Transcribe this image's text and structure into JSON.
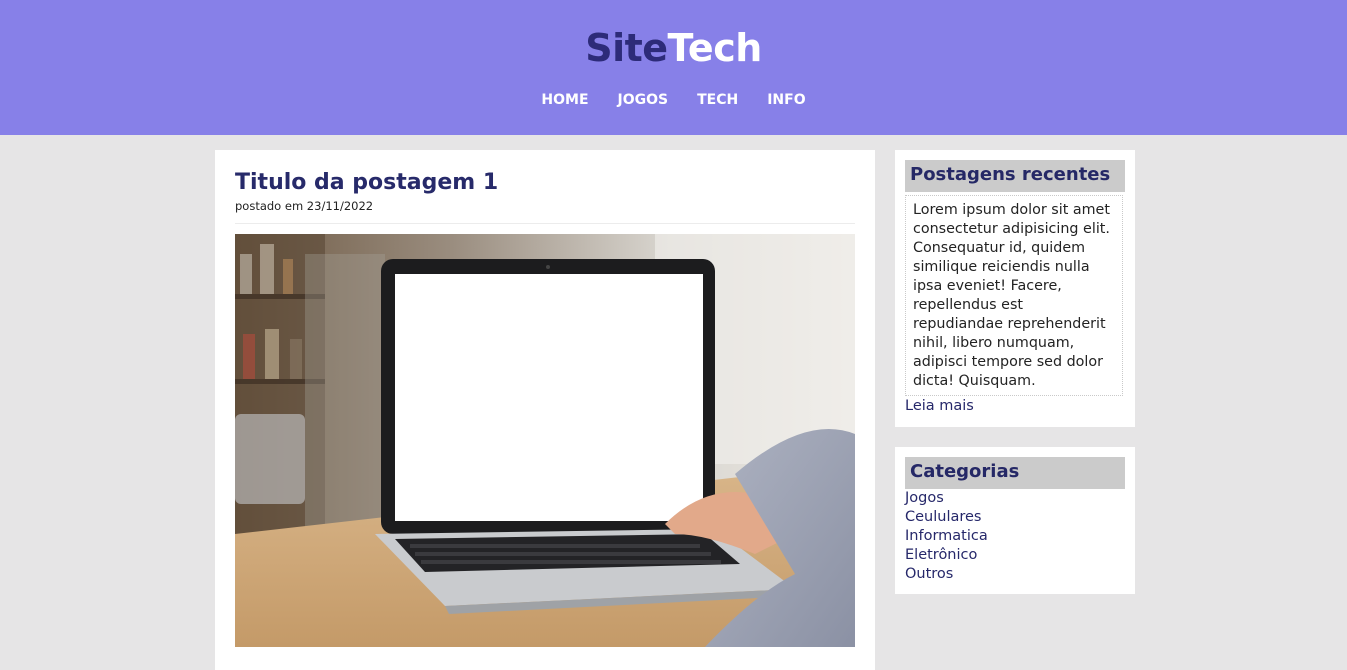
{
  "header": {
    "logo_part1": "Site",
    "logo_part2": "Tech",
    "nav": [
      "HOME",
      "JOGOS",
      "TECH",
      "INFO"
    ]
  },
  "post": {
    "title": "Titulo da postagem 1",
    "meta": "postado em 23/11/2022",
    "image_label": "laptop-on-desk-photo"
  },
  "sidebar": {
    "recent": {
      "title": "Postagens recentes",
      "text": "Lorem ipsum dolor sit amet consectetur adipisicing elit. Consequatur id, quidem similique reiciendis nulla ipsa eveniet! Facere, repellendus est repudiandae reprehenderit nihil, libero numquam, adipisci tempore sed dolor dicta! Quisquam.",
      "more": "Leia mais"
    },
    "categories": {
      "title": "Categorias",
      "items": [
        "Jogos",
        "Ceululares",
        "Informatica",
        "Eletrônico",
        "Outros"
      ]
    }
  },
  "colors": {
    "header_bg": "#8780e8",
    "logo_dark": "#2d2b79",
    "title_color": "#272a6a",
    "page_bg": "#e6e5e6",
    "widget_head_bg": "#cbcbcb"
  }
}
